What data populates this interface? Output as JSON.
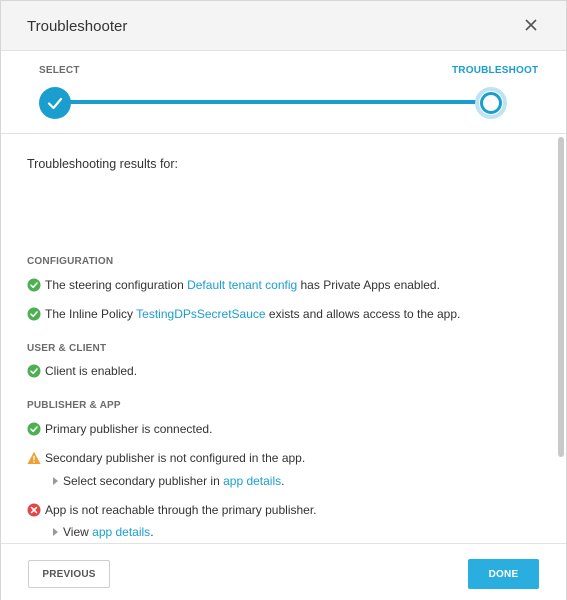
{
  "dialog": {
    "title": "Troubleshooter"
  },
  "stepper": {
    "steps": [
      {
        "label": "SELECT",
        "state": "complete"
      },
      {
        "label": "TROUBLESHOOT",
        "state": "current"
      }
    ]
  },
  "results": {
    "heading": "Troubleshooting results for:",
    "sections": [
      {
        "title": "CONFIGURATION",
        "items": [
          {
            "status": "success",
            "pre": "The steering configuration ",
            "link": "Default tenant config",
            "post": " has Private Apps enabled."
          },
          {
            "status": "success",
            "pre": "The Inline Policy ",
            "link": "TestingDPsSecretSauce",
            "post": " exists and allows access to the app."
          }
        ]
      },
      {
        "title": "USER & CLIENT",
        "items": [
          {
            "status": "success",
            "text": "Client is enabled."
          }
        ]
      },
      {
        "title": "PUBLISHER & APP",
        "items": [
          {
            "status": "success",
            "text": "Primary publisher is connected."
          },
          {
            "status": "warning",
            "text": "Secondary publisher is not configured in the app.",
            "hint": {
              "pre": "Select secondary publisher in ",
              "link": "app details",
              "post": "."
            }
          },
          {
            "status": "error",
            "text": "App is not reachable through the primary publisher.",
            "hint": {
              "pre": "View ",
              "link": "app details",
              "post": "."
            }
          }
        ]
      }
    ]
  },
  "footer": {
    "previous_label": "PREVIOUS",
    "done_label": "DONE"
  },
  "colors": {
    "accent": "#1a9ed0",
    "success": "#4caf50",
    "warning": "#f0a030",
    "error": "#e04848"
  },
  "icons": {
    "close": "close-icon",
    "success": "check-circle-icon",
    "warning": "warning-triangle-icon",
    "error": "error-circle-icon",
    "expand": "caret-right-icon"
  }
}
